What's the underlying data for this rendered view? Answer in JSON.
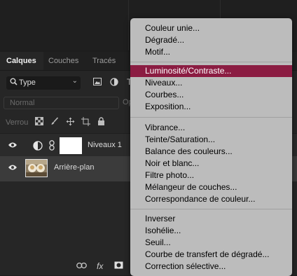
{
  "tabs": [
    "Calques",
    "Couches",
    "Tracés"
  ],
  "filter": {
    "label": "Type"
  },
  "blend": {
    "mode": "Normal",
    "opacity_label": "Op"
  },
  "lock": {
    "label": "Verrou"
  },
  "layers": [
    {
      "name": "Niveaux 1"
    },
    {
      "name": "Arrière-plan"
    }
  ],
  "bottom_icons": [
    "link-icon",
    "fx-icon",
    "mask-icon"
  ],
  "menu": {
    "highlight_color": "#8b1c42",
    "groups": [
      [
        "Couleur unie...",
        "Dégradé...",
        "Motif..."
      ],
      [
        "Luminosité/Contraste...",
        "Niveaux...",
        "Courbes...",
        "Exposition..."
      ],
      [
        "Vibrance...",
        "Teinte/Saturation...",
        "Balance des couleurs...",
        "Noir et blanc...",
        "Filtre photo...",
        "Mélangeur de couches...",
        "Correspondance de couleur..."
      ],
      [
        "Inverser",
        "Isohélie...",
        "Seuil...",
        "Courbe de transfert de dégradé...",
        "Correction sélective..."
      ]
    ],
    "highlighted": "Luminosité/Contraste..."
  }
}
